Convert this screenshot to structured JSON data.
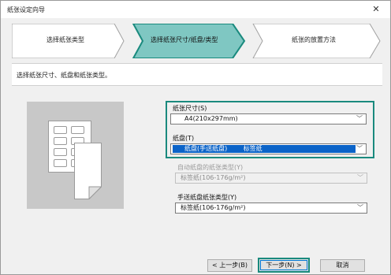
{
  "window": {
    "title": "纸张设定向导",
    "close_glyph": "✕"
  },
  "steps": [
    {
      "label": "选择纸张类型"
    },
    {
      "label": "选择纸张尺寸/纸盘/类型"
    },
    {
      "label": "纸张的放置方法"
    }
  ],
  "description": "选择纸张尺寸、纸盘和纸张类型。",
  "form": {
    "paper_size": {
      "label": "纸张尺寸(S)",
      "value": "A4(210x297mm)"
    },
    "tray": {
      "label": "纸盘(T)",
      "value": "纸盘(手送纸盘)        标签纸"
    },
    "auto_tray_type": {
      "label": "自动纸盘的纸张类型(Y)",
      "value": "标签纸(106-176g/m²)"
    },
    "manual_tray_type": {
      "label": "手送纸盘纸张类型(Y)",
      "value": "标签纸(106-176g/m²)"
    }
  },
  "buttons": {
    "back": "< 上一步(B)",
    "next": "下一步(N) >",
    "cancel": "取消"
  },
  "colors": {
    "accent_teal": "#1a8a7e",
    "active_step_fill": "#7fc7c2",
    "selection_blue": "#0b63c8"
  },
  "icons": [
    "close-icon",
    "chevron-down-icon",
    "label-sheet-icon"
  ]
}
